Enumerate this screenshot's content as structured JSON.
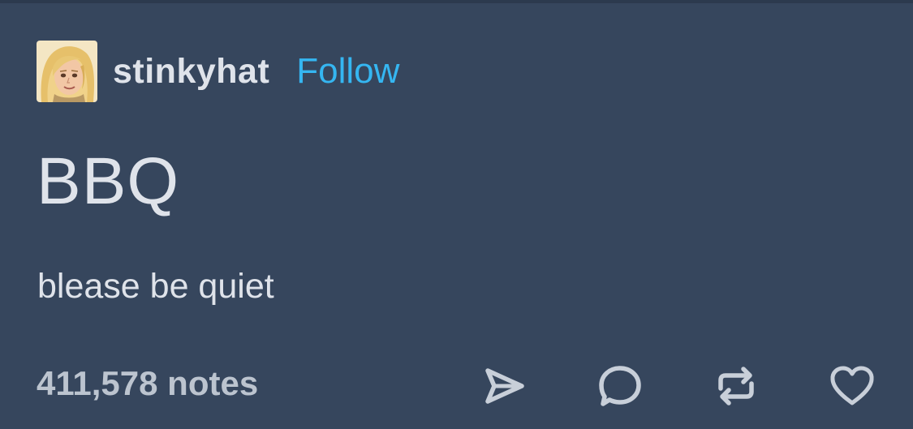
{
  "post": {
    "author": {
      "username": "stinkyhat",
      "follow_label": "Follow",
      "avatar_icon": "avatar-blonde-character"
    },
    "title": "BBQ",
    "body": "blease be quiet",
    "notes_label": "411,578 notes",
    "actions": [
      {
        "name": "share",
        "icon": "paper-plane-icon"
      },
      {
        "name": "reply",
        "icon": "speech-bubble-icon"
      },
      {
        "name": "reblog",
        "icon": "reblog-arrows-icon"
      },
      {
        "name": "like",
        "icon": "heart-icon"
      }
    ]
  },
  "colors": {
    "background": "#36465d",
    "text": "#dfe3ea",
    "muted_text": "#bcc4cf",
    "link": "#35b6f1",
    "icon": "#c8cfd9"
  }
}
